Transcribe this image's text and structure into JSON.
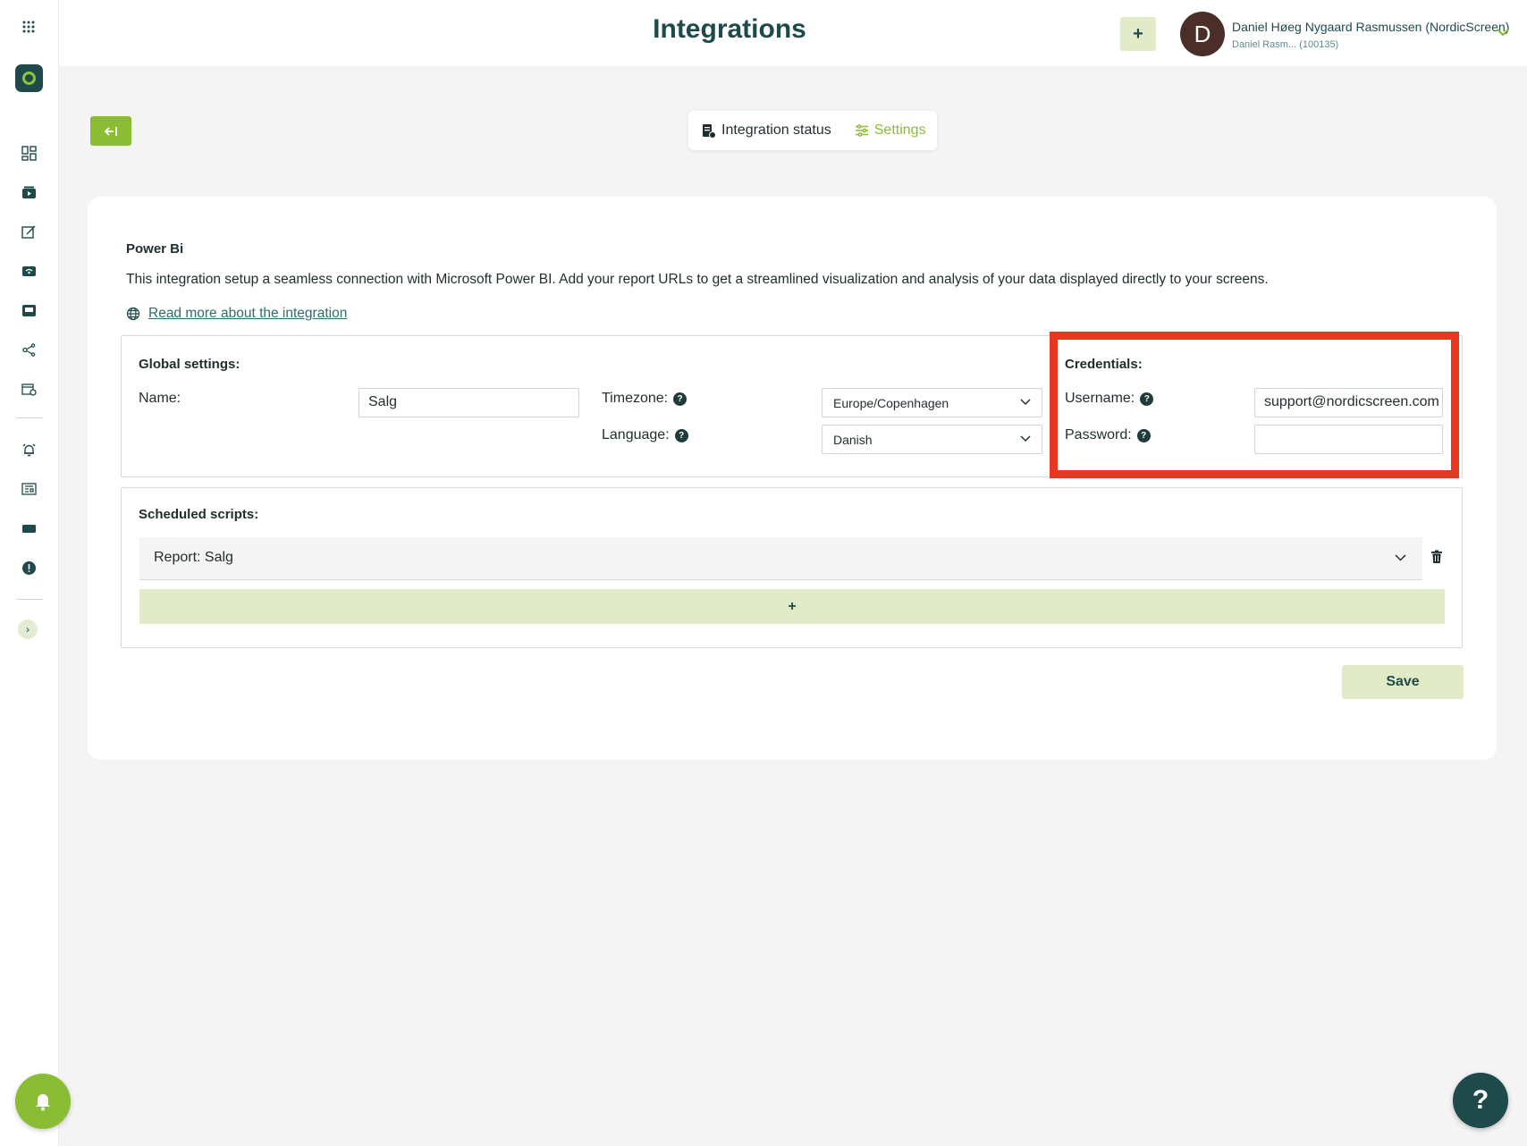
{
  "header": {
    "title": "Integrations",
    "add_label": "+",
    "avatar_initial": "D",
    "user_name": "Daniel Høeg Nygaard Rasmussen (NordicScreen)",
    "user_sub": "Daniel Rasm... (100135)"
  },
  "sidebar": {
    "items": [
      "apps-grid-icon",
      "logo",
      "dashboard-icon",
      "media-icon",
      "edit-icon",
      "wifi-icon",
      "display-icon",
      "share-icon",
      "calendar-icon",
      "alarm-icon",
      "news-icon",
      "card-icon",
      "alert-icon",
      "expand-icon"
    ]
  },
  "tabs": {
    "status": "Integration status",
    "settings": "Settings"
  },
  "integration": {
    "title": "Power Bi",
    "description": "This integration setup a seamless connection with Microsoft Power BI. Add your report URLs to get a streamlined visualization and analysis of your data displayed directly to your screens.",
    "read_more": "Read more about the integration"
  },
  "global": {
    "title": "Global settings:",
    "name_label": "Name:",
    "name_value": "Salg",
    "timezone_label": "Timezone:",
    "timezone_value": "Europe/Copenhagen",
    "language_label": "Language:",
    "language_value": "Danish"
  },
  "credentials": {
    "title": "Credentials:",
    "username_label": "Username:",
    "username_value": "support@nordicscreen.com",
    "password_label": "Password:",
    "password_value": ""
  },
  "scripts": {
    "title": "Scheduled scripts:",
    "report_label": "Report: Salg",
    "add_label": "+"
  },
  "actions": {
    "save_label": "Save"
  },
  "colors": {
    "brand_dark": "#1f4a4c",
    "brand_green": "#8bbd34",
    "highlight": "#e8371f"
  }
}
